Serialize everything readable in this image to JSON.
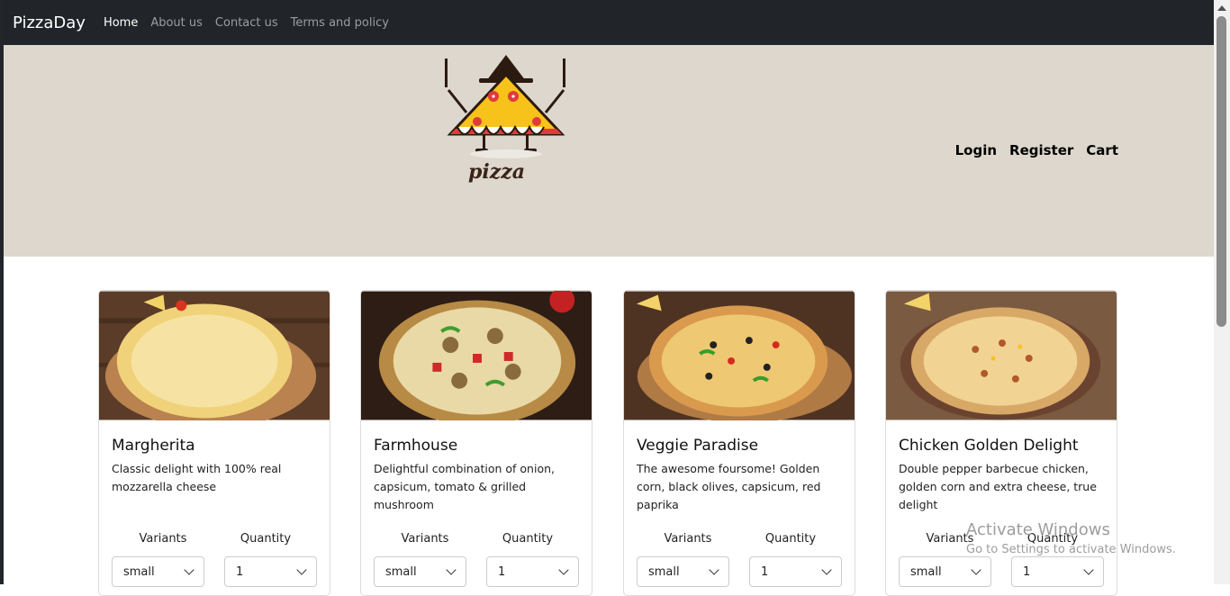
{
  "navbar": {
    "brand": "PizzaDay",
    "links": [
      "Home",
      "About us",
      "Contact us",
      "Terms and policy"
    ]
  },
  "hero": {
    "logo_text": "pizza",
    "auth": [
      "Login",
      "Register",
      "Cart"
    ]
  },
  "cards": [
    {
      "title": "Margherita",
      "desc": "Classic delight with 100% real mozzarella cheese",
      "variants_label": "Variants",
      "quantity_label": "Quantity",
      "variant": "small",
      "quantity": "1"
    },
    {
      "title": "Farmhouse",
      "desc": "Delightful combination of onion, capsicum, tomato & grilled mushroom",
      "variants_label": "Variants",
      "quantity_label": "Quantity",
      "variant": "small",
      "quantity": "1"
    },
    {
      "title": "Veggie Paradise",
      "desc": "The awesome foursome! Golden corn, black olives, capsicum, red paprika",
      "variants_label": "Variants",
      "quantity_label": "Quantity",
      "variant": "small",
      "quantity": "1"
    },
    {
      "title": "Chicken Golden Delight",
      "desc": "Double pepper barbecue chicken, golden corn and extra cheese, true delight",
      "variants_label": "Variants",
      "quantity_label": "Quantity",
      "variant": "small",
      "quantity": "1"
    }
  ],
  "watermark": {
    "line1": "Activate Windows",
    "line2": "Go to Settings to activate Windows."
  },
  "colors": {
    "navbar_bg": "#212529",
    "hero_bg": "#ddd7cd"
  }
}
